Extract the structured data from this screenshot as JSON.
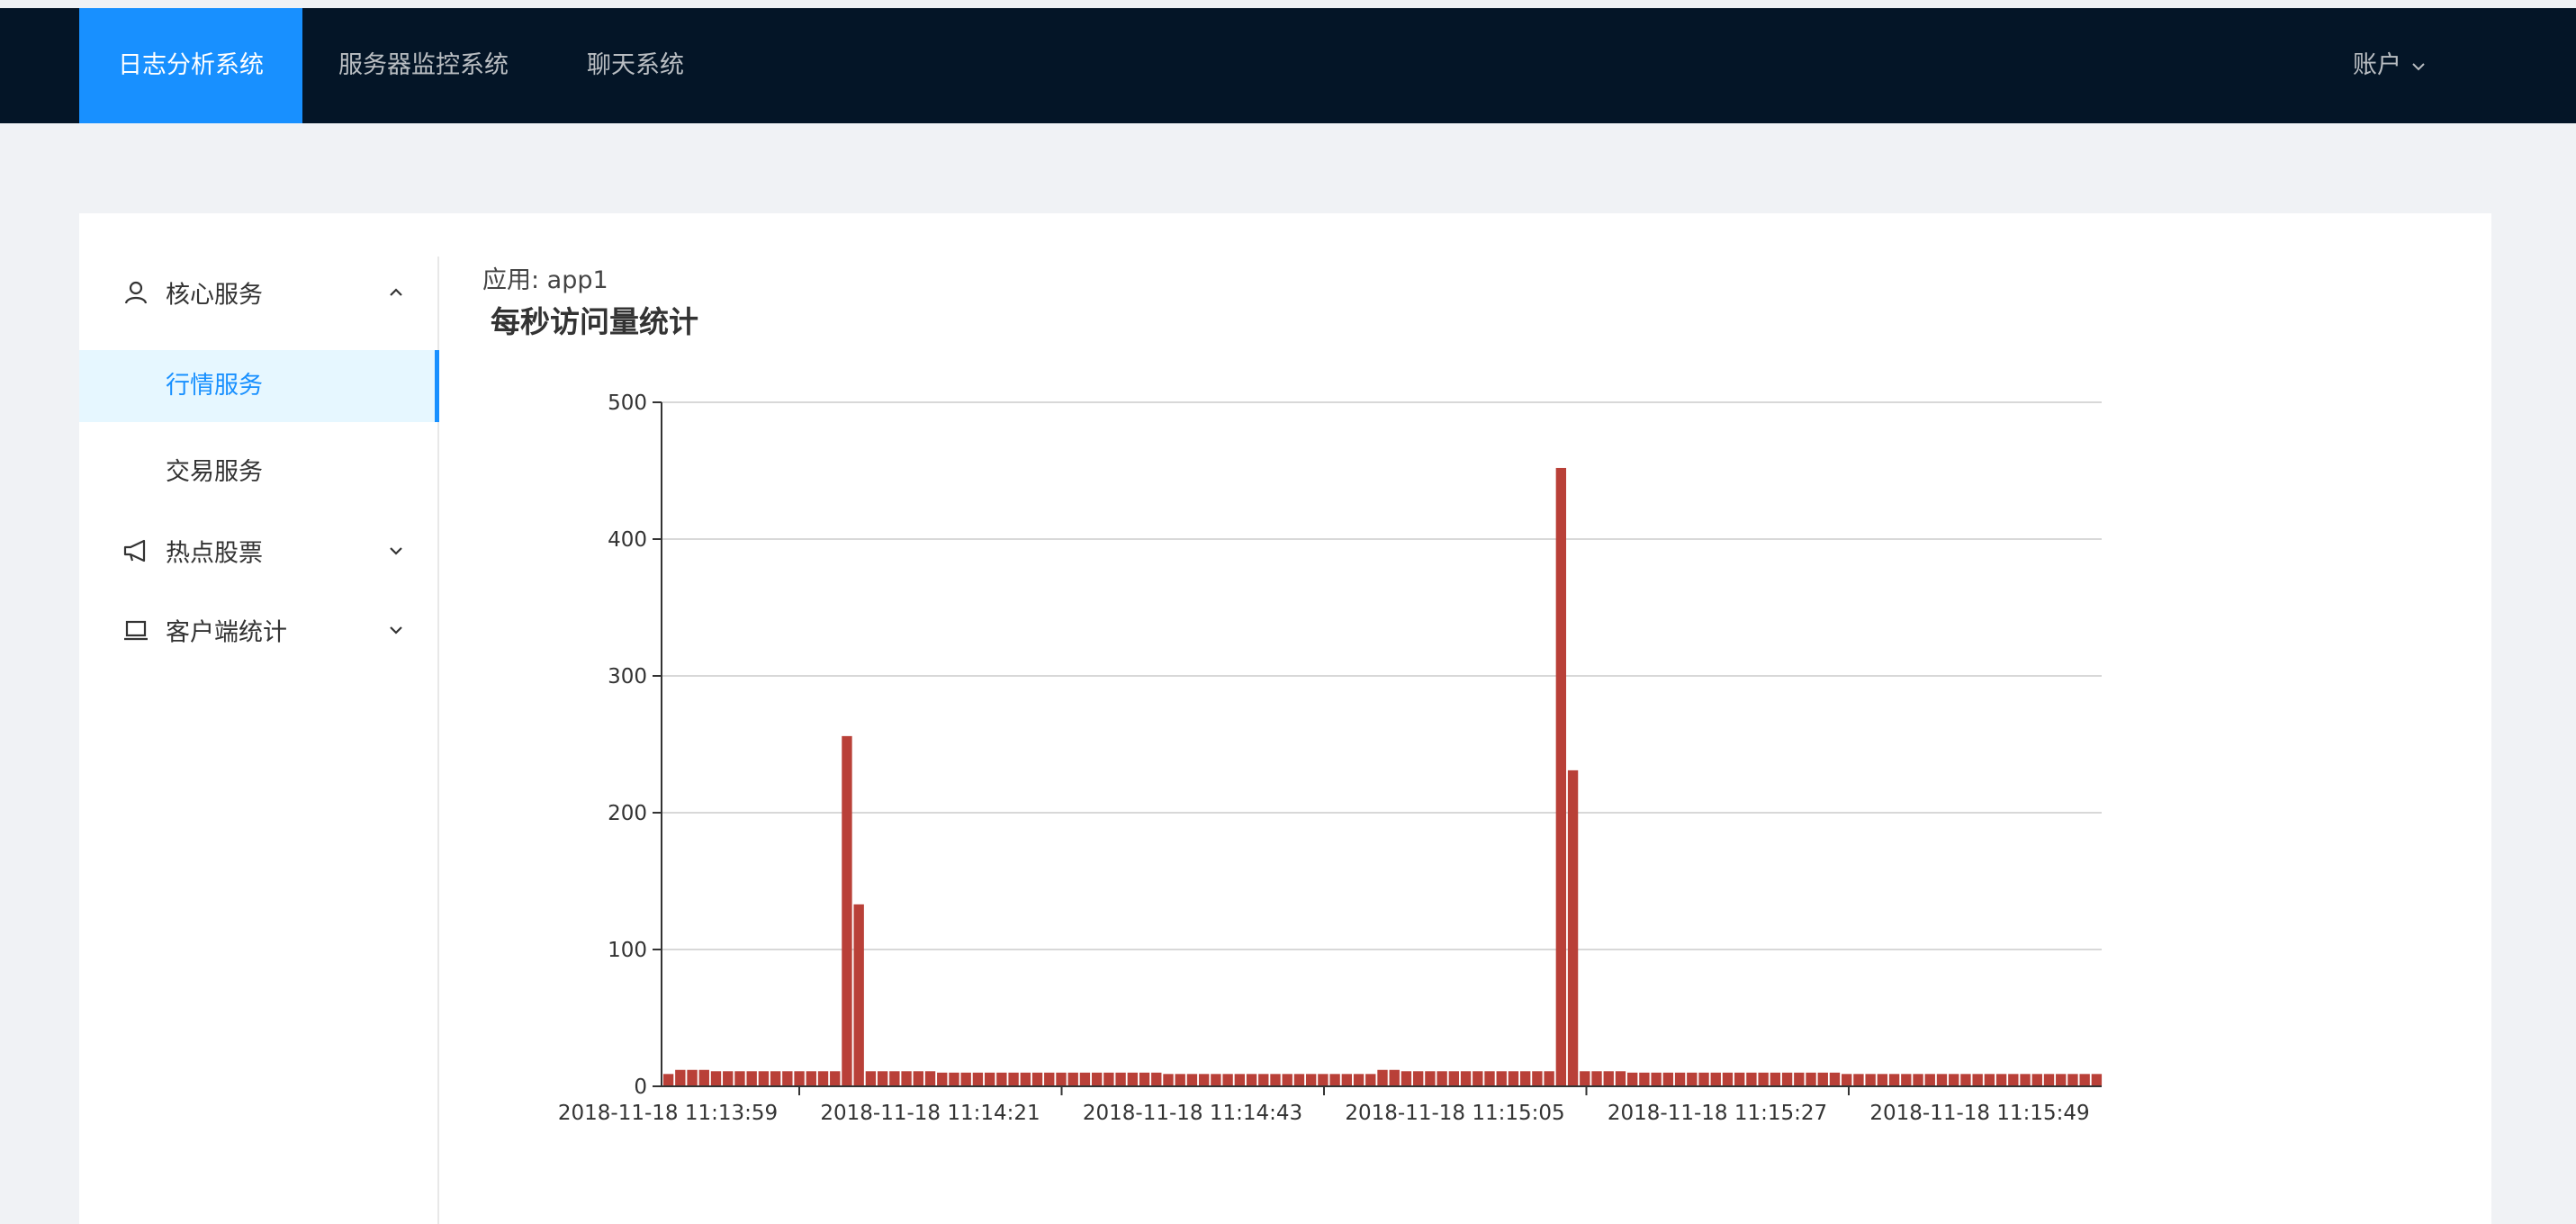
{
  "header": {
    "nav": [
      {
        "label": "日志分析系统",
        "active": true
      },
      {
        "label": "服务器监控系统",
        "active": false
      },
      {
        "label": "聊天系统",
        "active": false
      }
    ],
    "account_label": "账户",
    "bg_color": "#041527",
    "active_color": "#1890ff"
  },
  "sidebar": {
    "groups": [
      {
        "label": "核心服务",
        "icon": "user-icon",
        "expanded": true,
        "items": [
          {
            "label": "行情服务",
            "selected": true
          },
          {
            "label": "交易服务",
            "selected": false
          }
        ]
      },
      {
        "label": "热点股票",
        "icon": "megaphone-icon",
        "expanded": false,
        "items": []
      },
      {
        "label": "客户端统计",
        "icon": "laptop-icon",
        "expanded": false,
        "items": []
      }
    ]
  },
  "main": {
    "app_label": "应用: app1",
    "chart_title": "每秒访问量统计"
  },
  "chart_data": {
    "type": "bar",
    "title": "每秒访问量统计",
    "xlabel": "",
    "ylabel": "",
    "ylim": [
      0,
      500
    ],
    "yticks": [
      0,
      100,
      200,
      300,
      400,
      500
    ],
    "grid": true,
    "bar_color": "#b94038",
    "x_tick_labels": [
      "2018-11-18 11:13:59",
      "2018-11-18 11:14:21",
      "2018-11-18 11:14:43",
      "2018-11-18 11:15:05",
      "2018-11-18 11:15:27",
      "2018-11-18 11:15:49"
    ],
    "series": [
      {
        "values": [
          9,
          12,
          12,
          12,
          11,
          11,
          11,
          11,
          11,
          11,
          11,
          11,
          11,
          11,
          11,
          256,
          133,
          11,
          11,
          11,
          11,
          11,
          11,
          10,
          10,
          10,
          10,
          10,
          10,
          10,
          10,
          10,
          10,
          10,
          10,
          10,
          10,
          10,
          10,
          10,
          10,
          10,
          9,
          9,
          9,
          9,
          9,
          9,
          9,
          9,
          9,
          9,
          9,
          9,
          9,
          9,
          9,
          9,
          9,
          9,
          12,
          12,
          11,
          11,
          11,
          11,
          11,
          11,
          11,
          11,
          11,
          11,
          11,
          11,
          11,
          452,
          231,
          11,
          11,
          11,
          11,
          10,
          10,
          10,
          10,
          10,
          10,
          10,
          10,
          10,
          10,
          10,
          10,
          10,
          10,
          10,
          10,
          10,
          10,
          9,
          9,
          9,
          9,
          9,
          9,
          9,
          9,
          9,
          9,
          9,
          9,
          9,
          9,
          9,
          9,
          9,
          9,
          9,
          9,
          9,
          9
        ]
      }
    ]
  }
}
